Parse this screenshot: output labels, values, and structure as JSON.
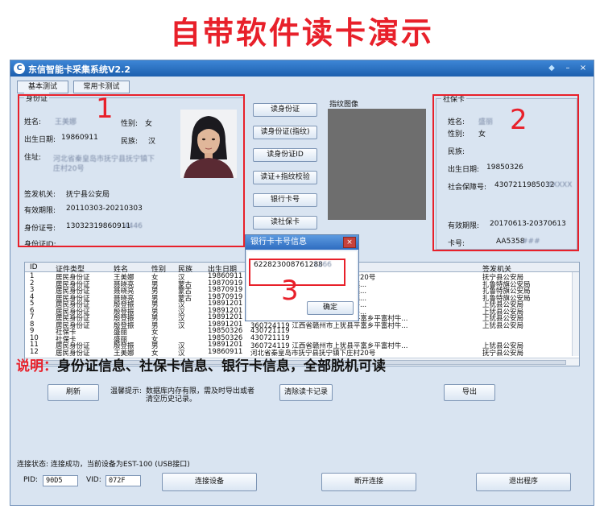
{
  "banner": {
    "title": "自带软件读卡演示"
  },
  "app": {
    "title": "东信智能卡采集系统V2.2",
    "logo": "C"
  },
  "titlebar": {
    "shield_icon": "shield-icon",
    "minimize": "–",
    "close": "×"
  },
  "tabs": [
    "基本测试",
    "常用卡测试"
  ],
  "idcard": {
    "group_title": "身份证",
    "name_label": "姓名:",
    "name_value": "王美娜",
    "gender_label": "性别:",
    "gender_value": "女",
    "birth_label": "出生日期:",
    "birth_value": "19860911",
    "ethnic_label": "民族:",
    "ethnic_value": "汉",
    "address_label": "住址:",
    "address_value_1": "河北省秦皇岛市抚宁县抚宁镇下",
    "address_value_2": "庄村20号",
    "issuer_label": "签发机关:",
    "issuer_value": "抚宁县公安局",
    "valid_label": "有效期限:",
    "valid_value": "20110303-20210303",
    "idno_label": "身份证号:",
    "idno_value": "13032319860911",
    "idno_masked": "4446",
    "cardid_label": "身份证ID:"
  },
  "actions": [
    "读身份证",
    "读身份证(指纹)",
    "读身份证ID",
    "读证+指纹校验",
    "银行卡号",
    "读社保卡"
  ],
  "fingerprint": {
    "title": "指纹图像"
  },
  "social": {
    "group_title": "社保卡",
    "name_label": "姓名:",
    "name_value": "盛丽",
    "gender_label": "性别:",
    "gender_value": "女",
    "ethnic_label": "民族:",
    "birth_label": "出生日期:",
    "birth_value": "19850326",
    "insno_label": "社会保障号:",
    "insno_value": "4307211985032",
    "insno_masked": "6XXXX",
    "valid_label": "有效期限:",
    "valid_value": "20170613-20370613",
    "cardno_label": "卡号:",
    "cardno_value": "AA5358",
    "cardno_masked": "###"
  },
  "markers": {
    "one": "1",
    "two": "2",
    "three": "3"
  },
  "table": {
    "headers": [
      "ID",
      "证件类型",
      "姓名",
      "性别",
      "民族",
      "出生日期",
      "",
      "签发机关"
    ],
    "rows": [
      [
        "1",
        "居民身份证",
        "王美娜",
        "女",
        "汉",
        "19860911",
        "河北省秦皇岛市抚宁县抚宁镇下庄村20号",
        "抚宁县公安局"
      ],
      [
        "2",
        "居民身份证",
        "聂晓亮",
        "男",
        "蒙古",
        "19870919",
        "内蒙古自治区通辽市扎鲁特旗鲁北镇...",
        "扎鲁特旗公安局"
      ],
      [
        "3",
        "居民身份证",
        "聂晓亮",
        "男",
        "蒙古",
        "19870919",
        "内蒙古自治区通辽市扎鲁特旗鲁北镇...",
        "扎鲁特旗公安局"
      ],
      [
        "4",
        "居民身份证",
        "聂晓亮",
        "男",
        "蒙古",
        "19870919",
        "内蒙古自治区通辽市扎鲁特旗鲁北镇...",
        "扎鲁特旗公安局"
      ],
      [
        "5",
        "居民身份证",
        "殷登振",
        "男",
        "汉",
        "19891201",
        "江西省赣州市上犹县平富乡平富村牛...",
        "上犹县公安局"
      ],
      [
        "6",
        "居民身份证",
        "殷登振",
        "男",
        "汉",
        "19891201",
        "江西省赣州市上犹县平富乡平富村牛...",
        "上犹县公安局"
      ],
      [
        "7",
        "居民身份证",
        "殷登振",
        "男",
        "汉",
        "19891201",
        "360724119  江西省赣州市上犹县平富乡平富村牛...",
        "上犹县公安局"
      ],
      [
        "8",
        "居民身份证",
        "殷登振",
        "男",
        "汉",
        "19891201",
        "360724119  江西省赣州市上犹县平富乡平富村牛...",
        "上犹县公安局"
      ],
      [
        "9",
        "社保卡",
        "盛丽",
        "女",
        "",
        "19850326",
        "430721119",
        ""
      ],
      [
        "10",
        "社保卡",
        "盛丽",
        "女",
        "",
        "19850326",
        "430721119",
        ""
      ],
      [
        "11",
        "居民身份证",
        "殷登振",
        "男",
        "汉",
        "19891201",
        "360724119  江西省赣州市上犹县平富乡平富村牛...",
        "上犹县公安局"
      ],
      [
        "12",
        "居民身份证",
        "王美娜",
        "女",
        "汉",
        "19860911",
        "河北省秦皇岛市抚宁县抚宁镇下庄村20号",
        "抚宁县公安局"
      ]
    ]
  },
  "dialog": {
    "title": "银行卡卡号信息",
    "card_no": "622823008761288",
    "card_masked": "1266",
    "ok": "确定",
    "close": "×"
  },
  "bottom": {
    "refresh": "刷新",
    "tip_label": "温馨提示:",
    "tip_text_1": "数据库内存有限，需及时导出或者",
    "tip_text_2": "清空历史记录。",
    "clear": "清除读卡记录",
    "export": "导出"
  },
  "note": {
    "key": "说明：",
    "text": "身份证信息、社保卡信息、银行卡信息，全部脱机可读"
  },
  "status": {
    "text": "连接状态: 连接成功，当前设备为EST-100 (USB接口)",
    "pid_label": "PID:",
    "pid_value": "90D5",
    "vid_label": "VID:",
    "vid_value": "072F",
    "connect": "连接设备",
    "disconnect": "断开连接",
    "exit": "退出程序"
  },
  "colors": {
    "accent_red": "#e8202a",
    "titlebar": "#2e6cc0",
    "window_bg": "#d9e4f1"
  }
}
